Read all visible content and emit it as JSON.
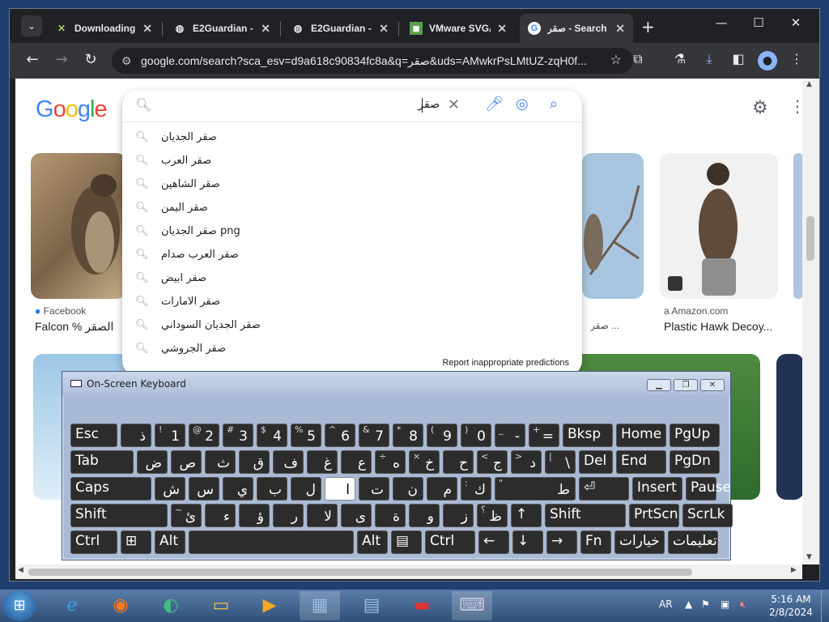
{
  "browser": {
    "tabs": [
      {
        "label": "Downloading",
        "icon": "x-icon"
      },
      {
        "label": "E2Guardian -",
        "icon": "globe-icon"
      },
      {
        "label": "E2Guardian -",
        "icon": "globe-icon"
      },
      {
        "label": "VMware SVGA",
        "icon": "vmware-icon"
      },
      {
        "label": "صقر - Search",
        "icon": "google-icon",
        "active": true
      }
    ],
    "url": "google.com/search?sca_esv=d9a618c90834fc8a&q=صقر&uds=AMwkrPsLMtUZ-zqH0f..."
  },
  "page": {
    "logo": "Google",
    "query": "صقر",
    "suggestions": [
      "صقر الجديان",
      "صقر العرب",
      "صقر الشاهين",
      "صقر اليمن",
      "صقر الجديان png",
      "صقر العرب صدام",
      "صقر ابيض",
      "صقر الامارات",
      "صقر الجديان السوداني",
      "صقر الجروشي"
    ],
    "report_link": "Report inappropriate predictions",
    "cards": [
      {
        "source": "Facebook",
        "title": "Falcon % الصقر"
      },
      {
        "source": "",
        "title": "صقر ..."
      },
      {
        "source": "Amazon.com",
        "title": "Plastic Hawk Decoy..."
      }
    ]
  },
  "osk": {
    "title": "On-Screen Keyboard",
    "rows": [
      [
        {
          "w": "Esc"
        },
        {
          "s": "",
          "m": "ذ"
        },
        {
          "s": "!",
          "m": "1"
        },
        {
          "s": "@",
          "m": "2"
        },
        {
          "s": "#",
          "m": "3"
        },
        {
          "s": "$",
          "m": "4"
        },
        {
          "s": "%",
          "m": "5"
        },
        {
          "s": "^",
          "m": "6"
        },
        {
          "s": "&",
          "m": "7"
        },
        {
          "s": "*",
          "m": "8"
        },
        {
          "s": "(",
          "m": "9"
        },
        {
          "s": ")",
          "m": "0"
        },
        {
          "s": "_",
          "m": "-"
        },
        {
          "s": "+",
          "m": "="
        },
        {
          "w": "Bksp"
        },
        {
          "w": "Home"
        },
        {
          "w": "PgUp"
        }
      ],
      [
        {
          "w": "Tab"
        },
        {
          "s": "",
          "m": "ض"
        },
        {
          "s": "",
          "m": "ص"
        },
        {
          "s": "",
          "m": "ث"
        },
        {
          "s": "",
          "m": "ق"
        },
        {
          "s": "",
          "m": "ف"
        },
        {
          "s": "",
          "m": "غ"
        },
        {
          "s": "",
          "m": "ع"
        },
        {
          "s": "÷",
          "m": "ه"
        },
        {
          "s": "×",
          "m": "خ"
        },
        {
          "s": "",
          "m": "ح"
        },
        {
          "s": "<",
          "m": "ج"
        },
        {
          "s": ">",
          "m": "د"
        },
        {
          "s": "|",
          "m": "\\"
        },
        {
          "w": "Del"
        },
        {
          "w": "End"
        },
        {
          "w": "PgDn"
        }
      ],
      [
        {
          "w": "Caps"
        },
        {
          "s": "",
          "m": "ش"
        },
        {
          "s": "",
          "m": "س"
        },
        {
          "s": "",
          "m": "ي"
        },
        {
          "s": "",
          "m": "ب"
        },
        {
          "s": "",
          "m": "ل"
        },
        {
          "s": "",
          "m": "ا"
        },
        {
          "s": "",
          "m": "ت"
        },
        {
          "s": "",
          "m": "ن"
        },
        {
          "s": "",
          "m": "م"
        },
        {
          "s": ":",
          "m": "ك"
        },
        {
          "s": "\"",
          "m": "ط"
        },
        {
          "w": "⏎"
        },
        {
          "w": "Insert"
        },
        {
          "w": "Pause"
        }
      ],
      [
        {
          "w": "Shift"
        },
        {
          "s": "~",
          "m": "ئ"
        },
        {
          "s": "",
          "m": "ء"
        },
        {
          "s": "",
          "m": "ؤ"
        },
        {
          "s": "",
          "m": "ر"
        },
        {
          "s": "",
          "m": "لا"
        },
        {
          "s": "",
          "m": "ى"
        },
        {
          "s": "",
          "m": "ة"
        },
        {
          "s": "",
          "m": "و"
        },
        {
          "s": "",
          "m": "ز"
        },
        {
          "s": "؟",
          "m": "ظ"
        },
        {
          "w": "↑"
        },
        {
          "w": "Shift"
        },
        {
          "w": "PrtScn"
        },
        {
          "w": "ScrLk"
        }
      ],
      [
        {
          "w": "Ctrl"
        },
        {
          "w": "⊞"
        },
        {
          "w": "Alt"
        },
        {
          "w": ""
        },
        {
          "w": "Alt"
        },
        {
          "w": "▤"
        },
        {
          "w": "Ctrl"
        },
        {
          "w": "←"
        },
        {
          "w": "↓"
        },
        {
          "w": "→"
        },
        {
          "w": "Fn"
        },
        {
          "w": "خيارات"
        },
        {
          "w": "تعليمات"
        }
      ]
    ]
  },
  "taskbar": {
    "lang": "AR",
    "time": "5:16 AM",
    "date": "2/8/2024"
  }
}
